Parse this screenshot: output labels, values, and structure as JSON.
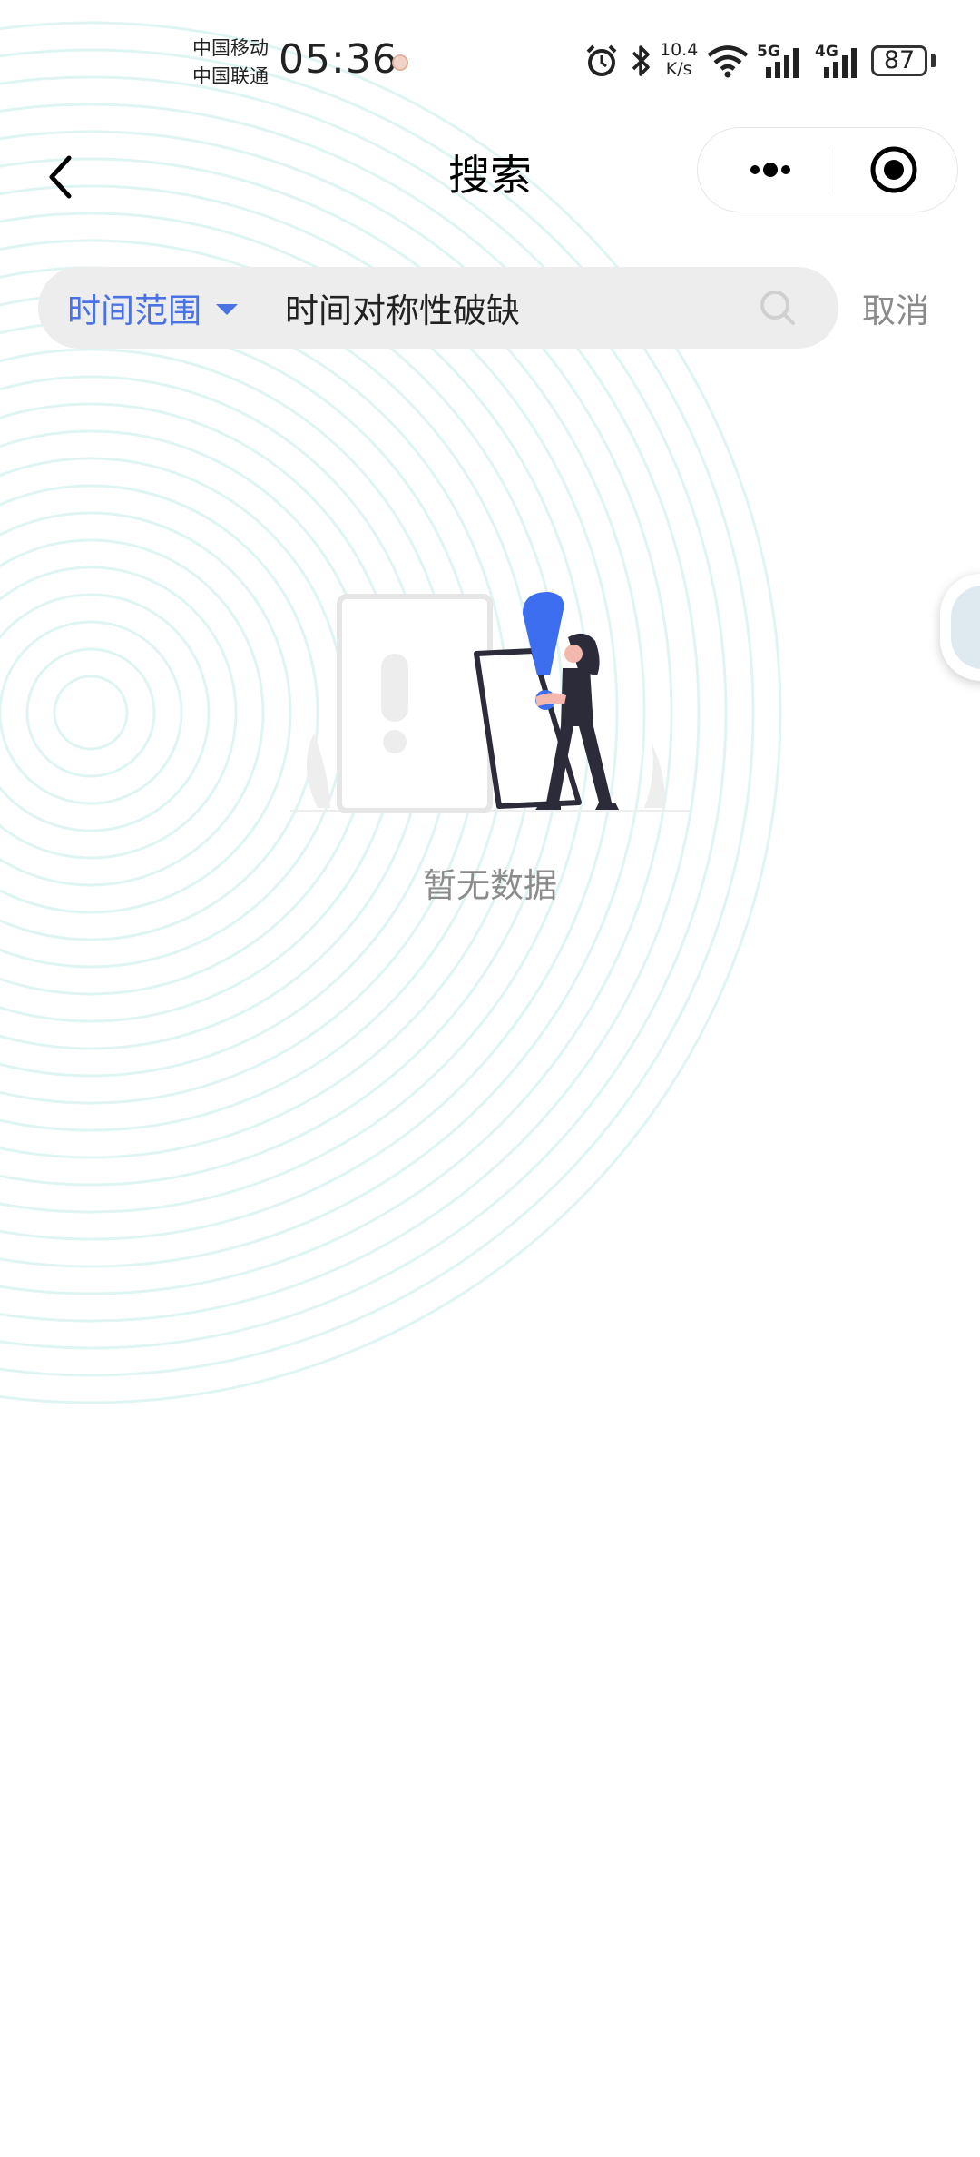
{
  "status_bar": {
    "carrier_1": "中国移动",
    "carrier_2": "中国联通",
    "time": "05:36",
    "net_speed_value": "10.4",
    "net_speed_unit": "K/s",
    "signal_1_label": "5G",
    "signal_2_label": "4G",
    "battery": "87"
  },
  "nav": {
    "title": "搜索"
  },
  "search": {
    "range_label": "时间范围",
    "query": "时间对称性破缺",
    "cancel_label": "取消"
  },
  "empty_state": {
    "message": "暂无数据"
  },
  "colors": {
    "accent": "#4a72e3",
    "illustration_blue": "#3d6ef0",
    "ring": "#dff5f3"
  }
}
